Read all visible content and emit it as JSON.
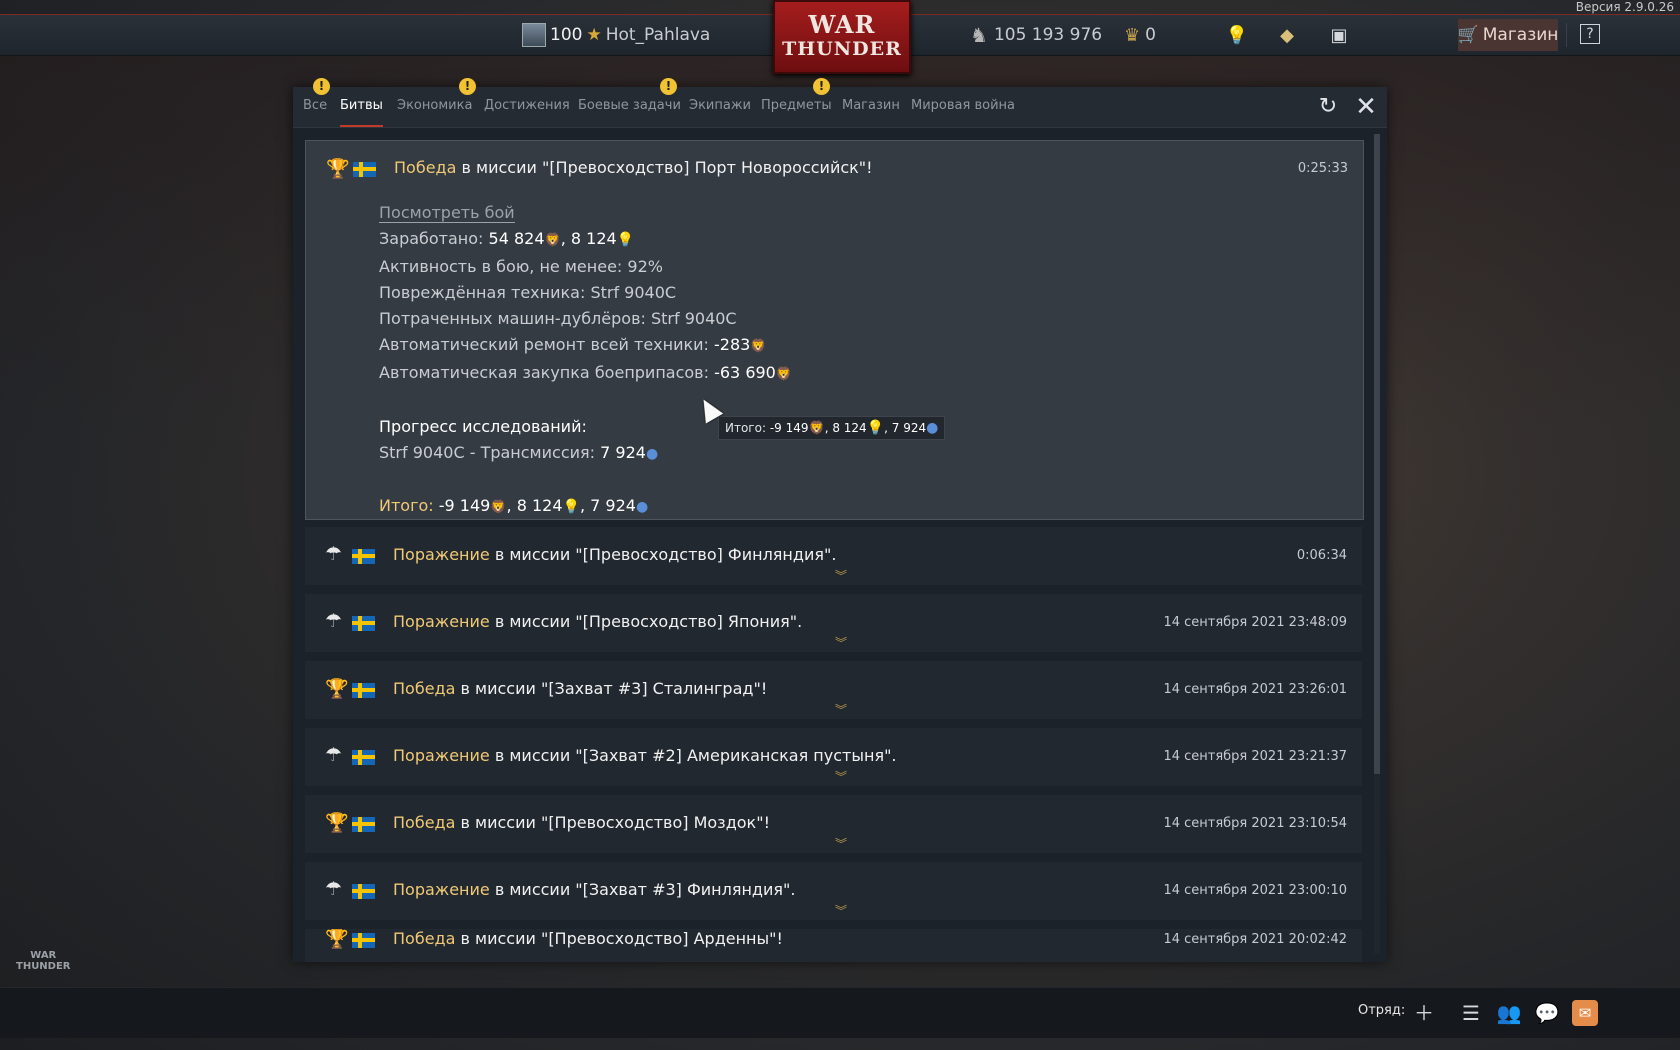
{
  "version": "Версия 2.9.0.26",
  "topbar": {
    "rank": "100",
    "username": "Hot_Pahlava",
    "logo_line1": "WAR",
    "logo_line2": "THUNDER",
    "silver_lions": "105 193 976",
    "golden_eagles": "0",
    "shop_label": "Магазин",
    "help_label": "?"
  },
  "tabs": [
    {
      "label": "Все",
      "warning": true
    },
    {
      "label": "Битвы",
      "warning": false,
      "active": true
    },
    {
      "label": "Экономика",
      "warning": true
    },
    {
      "label": "Достижения",
      "warning": false
    },
    {
      "label": "Боевые задачи",
      "warning": true
    },
    {
      "label": "Экипажи",
      "warning": false
    },
    {
      "label": "Предметы",
      "warning": true
    },
    {
      "label": "Магазин",
      "warning": false
    },
    {
      "label": "Мировая война",
      "warning": false
    }
  ],
  "expanded": {
    "result": "Победа",
    "mission": " в миссии \"[Превосходство] Порт Новороссийск\"!",
    "time": "0:25:33",
    "view_battle": "Посмотреть бой",
    "earned_label": "Заработано: ",
    "earned_value": "54 824",
    "earned_rp": ", 8 124",
    "activity": "Активность в бою, не менее: 92%",
    "damaged": "Повреждённая техника: Strf 9040C",
    "spent": "Потраченных машин-дублёров: Strf 9040C",
    "repair_label": "Автоматический ремонт всей техники: ",
    "repair_value": "-283",
    "ammo_label": "Автоматическая закупка боеприпасов: ",
    "ammo_value": "-63 690",
    "research_title": "Прогресс исследований:",
    "research_item": "Strf 9040C - Трансмиссия: ",
    "research_value": "7 924",
    "total_label": "Итого:",
    "total_silver": " -9 149",
    "total_rp": ", 8 124",
    "total_rp2": ", 7 924"
  },
  "tooltip": {
    "label": "Итого: ",
    "silver": "-9 149",
    "rp": ", 8 124",
    "rp2": ", 7 924"
  },
  "entries": [
    {
      "result": "Поражение",
      "mission": " в миссии \"[Превосходство] Финляндия\".",
      "time": "0:06:34",
      "icon": "parachute-icon"
    },
    {
      "result": "Поражение",
      "mission": " в миссии \"[Превосходство] Япония\".",
      "time": "14 сентября 2021 23:48:09",
      "icon": "parachute-icon"
    },
    {
      "result": "Победа",
      "mission": " в миссии \"[Захват #3] Сталинград\"!",
      "time": "14 сентября 2021 23:26:01",
      "icon": "trophy-icon"
    },
    {
      "result": "Поражение",
      "mission": " в миссии \"[Захват #2] Американская пустыня\".",
      "time": "14 сентября 2021 23:21:37",
      "icon": "parachute-icon"
    },
    {
      "result": "Победа",
      "mission": " в миссии \"[Превосходство] Моздок\"!",
      "time": "14 сентября 2021 23:10:54",
      "icon": "trophy-icon"
    },
    {
      "result": "Поражение",
      "mission": " в миссии \"[Захват #3] Финляндия\".",
      "time": "14 сентября 2021 23:00:10",
      "icon": "parachute-icon"
    },
    {
      "result": "Победа",
      "mission": " в миссии \"[Превосходство] Арденны\"!",
      "time": "14 сентября 2021 20:02:42",
      "icon": "trophy-icon"
    }
  ],
  "bottombar": {
    "squad_label": "Отряд:"
  },
  "watermark": {
    "line1": "WAR",
    "line2": "THUNDER"
  }
}
